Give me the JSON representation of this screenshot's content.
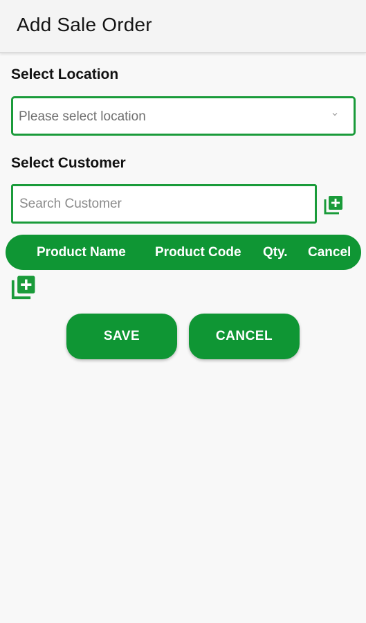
{
  "app_bar": {
    "title": "Add Sale Order"
  },
  "location": {
    "label": "Select Location",
    "placeholder": "Please select location",
    "chevron_icon": "chevron-down-icon"
  },
  "customer": {
    "label": "Select Customer",
    "search_placeholder": "Search Customer",
    "add_icon": "add-box-icon"
  },
  "product_table": {
    "columns": [
      "Product Name",
      "Product Code",
      "Qty.",
      "Cancel"
    ],
    "add_icon": "add-box-icon"
  },
  "actions": {
    "save_label": "SAVE",
    "cancel_label": "CANCEL"
  },
  "colors": {
    "accent": "#0f9634",
    "border": "#1a9b3a",
    "background": "#f8f8f8"
  }
}
